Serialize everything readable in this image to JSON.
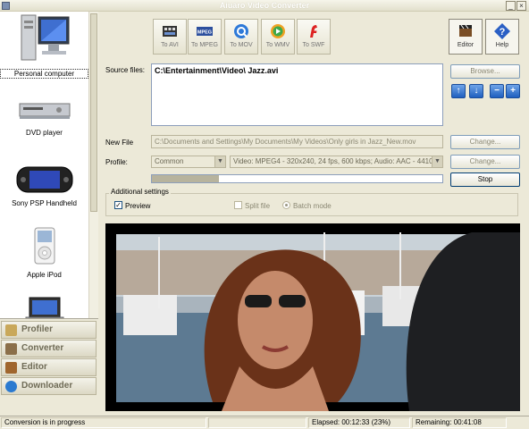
{
  "window": {
    "title": "Aiuaro Video Converter"
  },
  "sidebar": {
    "devices": [
      {
        "label": "Personal computer",
        "icon": "computer-icon",
        "selected": true
      },
      {
        "label": "DVD player",
        "icon": "dvd-player-icon",
        "selected": false
      },
      {
        "label": "Sony PSP Handheld",
        "icon": "psp-icon",
        "selected": false
      },
      {
        "label": "Apple iPod",
        "icon": "ipod-icon",
        "selected": false
      },
      {
        "label": "",
        "icon": "laptop-icon",
        "selected": false
      }
    ],
    "nav": [
      {
        "label": "Profiler",
        "icon": "profiler-icon"
      },
      {
        "label": "Converter",
        "icon": "converter-icon"
      },
      {
        "label": "Editor",
        "icon": "editor-icon"
      },
      {
        "label": "Downloader",
        "icon": "downloader-icon"
      }
    ]
  },
  "toolbar": {
    "buttons": [
      {
        "label": "To AVI",
        "icon": "film-icon"
      },
      {
        "label": "To MPEG",
        "icon": "mpeg-icon"
      },
      {
        "label": "To MOV",
        "icon": "quicktime-icon"
      },
      {
        "label": "To WMV",
        "icon": "media-player-icon"
      },
      {
        "label": "To SWF",
        "icon": "flash-icon"
      }
    ],
    "editor_label": "Editor",
    "help_label": "Help"
  },
  "form": {
    "source_label": "Source files:",
    "source_value": "C:\\Entertainment\\Video\\ Jazz.avi",
    "browse_label": "Browse...",
    "newfile_label": "New File",
    "newfile_value": "C:\\Documents and Settings\\My Documents\\My Videos\\Only girls in Jazz_New.mov",
    "change_label": "Change...",
    "profile_label": "Profile:",
    "profile_value": "Common",
    "profile_detail": "Video: MPEG4 - 320x240, 24 fps, 600 kbps; Audio: AAC - 44100 Hz,",
    "change2_label": "Change...",
    "stop_label": "Stop",
    "progress_fraction": 0.23
  },
  "settings": {
    "title": "Additional settings",
    "preview_label": "Preview",
    "preview_checked": true,
    "split_label": "Split file",
    "batch_label": "Batch mode"
  },
  "status": {
    "message": "Conversion is in progress",
    "elapsed": "Elapsed: 00:12:33 (23%)",
    "remaining": "Remaining: 00:41:08"
  },
  "colors": {
    "accent": "#1f5fbf",
    "window": "#ece9d8"
  }
}
